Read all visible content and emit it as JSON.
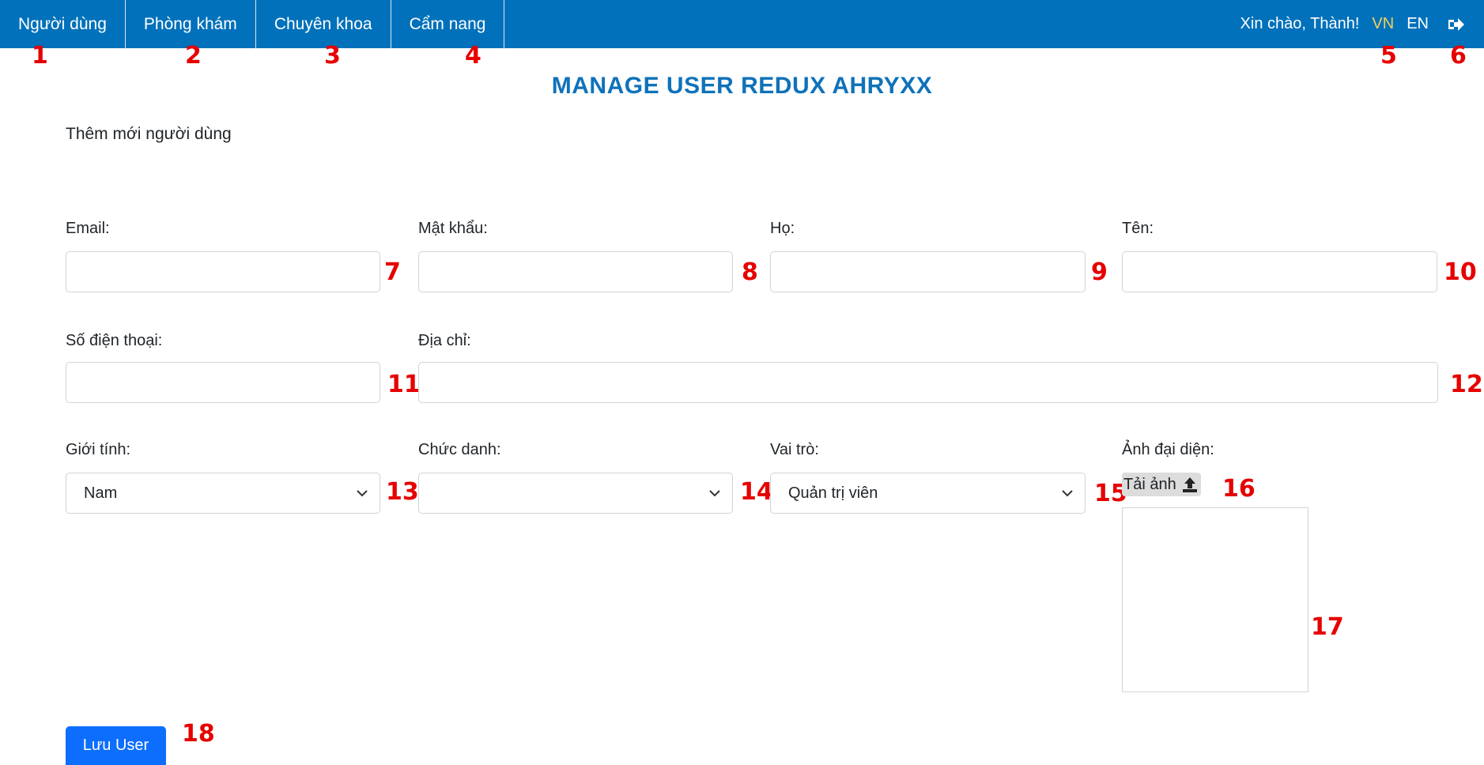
{
  "nav": {
    "items": [
      {
        "label": "Người dùng"
      },
      {
        "label": "Phòng khám"
      },
      {
        "label": "Chuyên khoa"
      },
      {
        "label": "Cẩm nang"
      }
    ]
  },
  "header": {
    "welcome": "Xin chào, Thành!",
    "lang_vn": "VN",
    "lang_en": "EN",
    "logout_icon": "sign-out-icon"
  },
  "page": {
    "title": "MANAGE USER REDUX AHRYXX",
    "subtitle": "Thêm mới người dùng"
  },
  "form": {
    "email": {
      "label": "Email:",
      "value": ""
    },
    "password": {
      "label": "Mật khẩu:",
      "value": ""
    },
    "first_name": {
      "label": "Họ:",
      "value": ""
    },
    "last_name": {
      "label": "Tên:",
      "value": ""
    },
    "phone": {
      "label": "Số điện thoại:",
      "value": ""
    },
    "address": {
      "label": "Địa chỉ:",
      "value": ""
    },
    "gender": {
      "label": "Giới tính:",
      "value": "Nam"
    },
    "position": {
      "label": "Chức danh:",
      "value": ""
    },
    "role": {
      "label": "Vai trò:",
      "value": "Quản trị viên"
    },
    "avatar": {
      "label": "Ảnh đại diện:",
      "upload_label": "Tải ảnh",
      "upload_icon": "upload-icon"
    },
    "save_label": "Lưu User"
  },
  "callouts": [
    "1",
    "2",
    "3",
    "4",
    "5",
    "6",
    "7",
    "8",
    "9",
    "10",
    "11",
    "12",
    "13",
    "14",
    "15",
    "16",
    "17",
    "18"
  ],
  "colors": {
    "header_bg": "#0071ba",
    "title": "#0f72b9",
    "primary_button": "#0d6efd",
    "callout": "#e60000",
    "active_lang": "#f0d060"
  }
}
